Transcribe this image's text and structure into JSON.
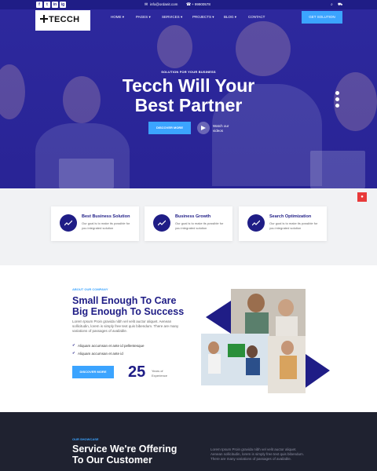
{
  "topbar": {
    "social": [
      "f",
      "t",
      "in",
      "ig"
    ],
    "email": "info@ordanit.com",
    "phone": "+ 99900578"
  },
  "logo": {
    "text": "TECCH"
  },
  "nav": {
    "items": [
      {
        "label": "HOME"
      },
      {
        "label": "PAGES"
      },
      {
        "label": "SERVICES"
      },
      {
        "label": "PROJECTS"
      },
      {
        "label": "BLOG"
      },
      {
        "label": "CONTACT"
      }
    ],
    "cta": "GET SOLUTION"
  },
  "hero": {
    "kicker": "SOLUTION FOR YOUR BUSINESS",
    "title_line1": "Tecch Will Your",
    "title_line2": "Best Partner",
    "button": "DISCOVER MORE",
    "watch_line1": "Watch our",
    "watch_line2": "videos"
  },
  "features": [
    {
      "title": "Best Business Solution",
      "desc": "Our goal is to make its possible for you integrated solution"
    },
    {
      "title": "Business Growth",
      "desc": "Our goal is to make its possible for you integrated solution"
    },
    {
      "title": "Search Optimization",
      "desc": "Our goal is to make its possible for you integrated solution"
    }
  ],
  "about": {
    "kicker": "ABOUT OUR COMPANY",
    "title_line1": "Small Enough To Care",
    "title_line2": "Big Enough To Success",
    "para": "Lorem Ipsum Proin gravida nibh vel velit auctor aliquet. Aenean sollicitudin, lorem is simply free text quis bibendum. There are many variations of passages of available.",
    "checks": [
      "Aliquam accumsan et ante id pellentesque",
      "Aliquam accumsan et ante id"
    ],
    "button": "DISCOVER MORE",
    "years": "25",
    "years_line1": "Years of",
    "years_line2": "Experience"
  },
  "showcase": {
    "kicker": "OUR SHOWCASE",
    "title_line1": "Service We're Offering",
    "title_line2": "To Our Customer",
    "para": "Lorem Ipsum Proin gravida nibh vel velit auctor aliquet. Aenean sollicitudin, lorem is simply free text quis bibendum. There are many variations of passages of available."
  },
  "colors": {
    "primary": "#1f1d86",
    "accent": "#3ba4ff",
    "dark": "#1f2230",
    "red": "#e83a3a"
  }
}
